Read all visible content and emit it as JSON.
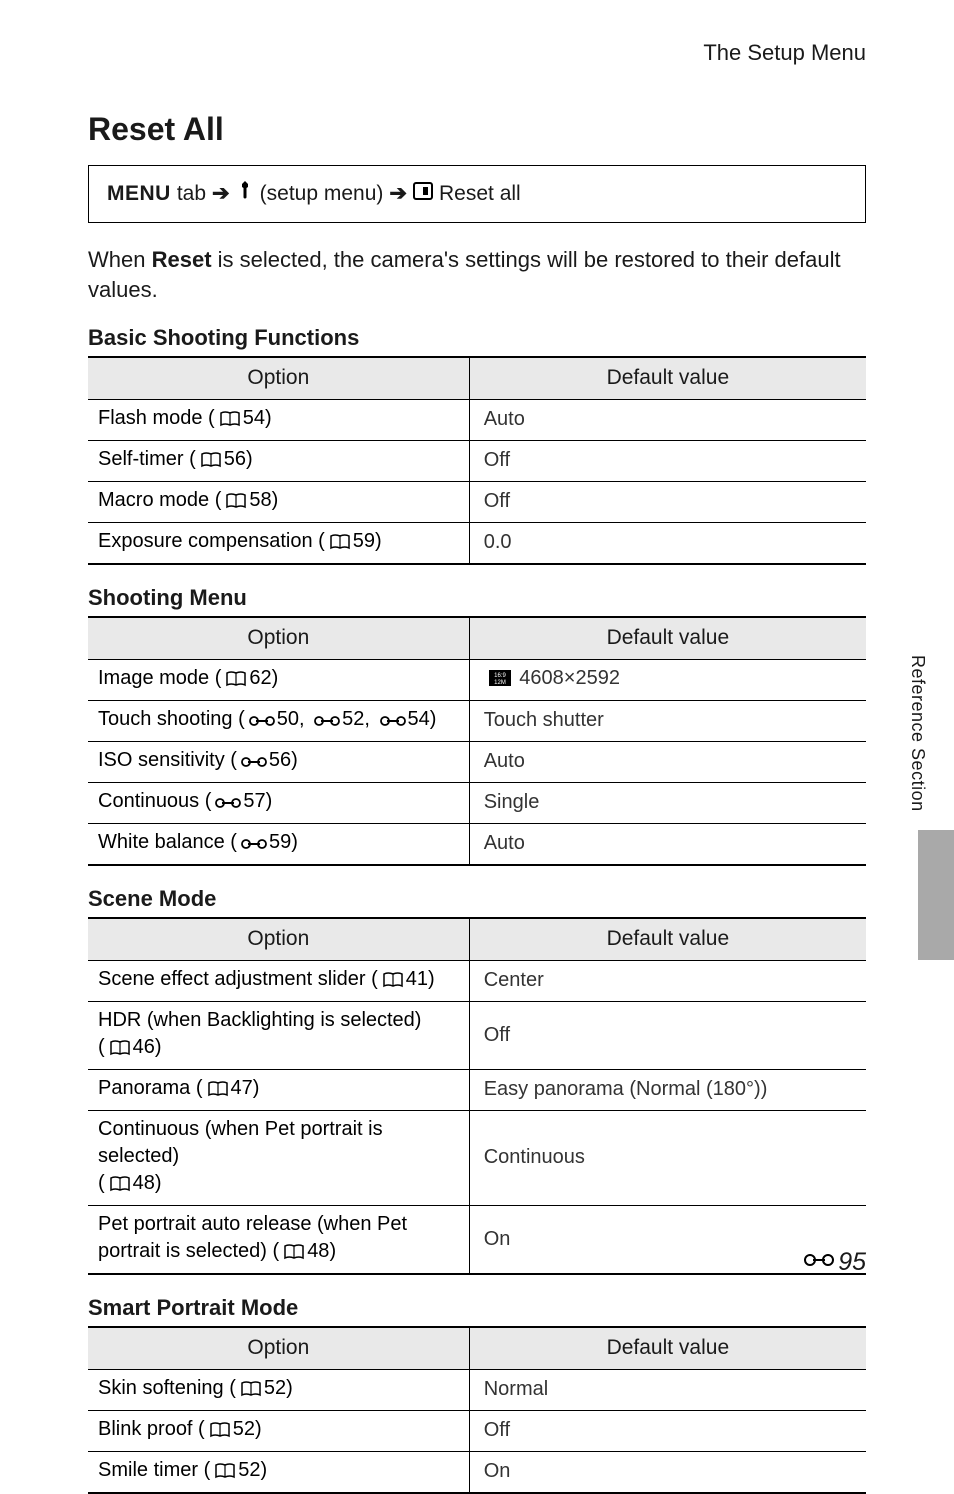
{
  "header": {
    "breadcrumb_label": "The Setup Menu"
  },
  "title": "Reset All",
  "nav": {
    "menu_word": "MENU",
    "tab_word": "tab",
    "setup_menu": "(setup menu)",
    "reset_all": "Reset all"
  },
  "intro": {
    "pre": "When ",
    "bold": "Reset",
    "post": " is selected, the camera's settings will be restored to their default values."
  },
  "column_headers": {
    "option": "Option",
    "default": "Default value"
  },
  "sections": [
    {
      "title": "Basic Shooting Functions",
      "rows": [
        {
          "option": "Flash mode",
          "ref_type": "book",
          "refs": [
            "54"
          ],
          "value": "Auto"
        },
        {
          "option": "Self-timer",
          "ref_type": "book",
          "refs": [
            "56"
          ],
          "value": "Off"
        },
        {
          "option": "Macro mode",
          "ref_type": "book",
          "refs": [
            "58"
          ],
          "value": "Off"
        },
        {
          "option": "Exposure compensation",
          "ref_type": "book",
          "refs": [
            "59"
          ],
          "value": "0.0"
        }
      ]
    },
    {
      "title": "Shooting Menu",
      "rows": [
        {
          "option": "Image mode",
          "ref_type": "book",
          "refs": [
            "62"
          ],
          "value": "4608×2592",
          "value_icon": "image-mode"
        },
        {
          "option": "Touch shooting",
          "ref_type": "tab",
          "refs": [
            "50",
            "52",
            "54"
          ],
          "value": "Touch shutter"
        },
        {
          "option": "ISO sensitivity",
          "ref_type": "tab",
          "refs": [
            "56"
          ],
          "value": "Auto"
        },
        {
          "option": "Continuous",
          "ref_type": "tab",
          "refs": [
            "57"
          ],
          "value": "Single"
        },
        {
          "option": "White balance",
          "ref_type": "tab",
          "refs": [
            "59"
          ],
          "value": "Auto"
        }
      ]
    },
    {
      "title": "Scene Mode",
      "rows": [
        {
          "option": "Scene effect adjustment slider",
          "ref_type": "book",
          "refs": [
            "41"
          ],
          "value": "Center"
        },
        {
          "option": "HDR (when Backlighting is selected)",
          "ref_type": "book",
          "refs": [
            "46"
          ],
          "option_break": true,
          "value": "Off"
        },
        {
          "option": "Panorama",
          "ref_type": "book",
          "refs": [
            "47"
          ],
          "value": "Easy panorama (Normal (180°))"
        },
        {
          "option": "Continuous (when Pet portrait is selected)",
          "ref_type": "book",
          "refs": [
            "48"
          ],
          "option_break": true,
          "value": "Continuous"
        },
        {
          "option": "Pet portrait auto release (when Pet portrait is selected)",
          "ref_type": "book",
          "refs": [
            "48"
          ],
          "value": "On"
        }
      ]
    },
    {
      "title": "Smart Portrait Mode",
      "rows": [
        {
          "option": "Skin softening",
          "ref_type": "book",
          "refs": [
            "52"
          ],
          "value": "Normal"
        },
        {
          "option": "Blink proof",
          "ref_type": "book",
          "refs": [
            "52"
          ],
          "value": "Off"
        },
        {
          "option": "Smile timer",
          "ref_type": "book",
          "refs": [
            "52"
          ],
          "value": "On"
        }
      ]
    }
  ],
  "side_text": "Reference Section",
  "page_number": "95"
}
